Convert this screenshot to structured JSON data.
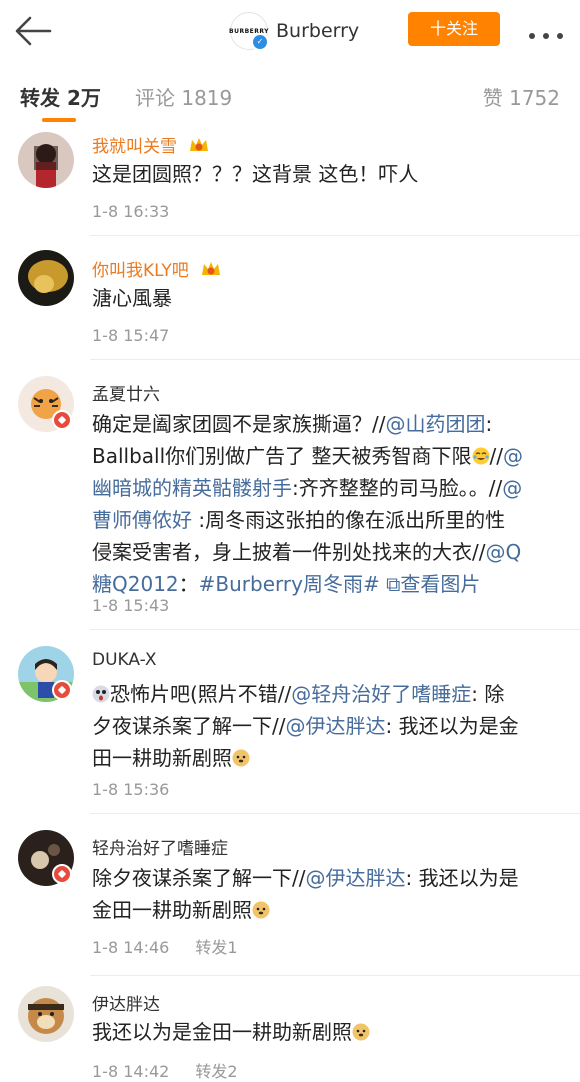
{
  "header": {
    "back_icon": "arrow-left-icon",
    "brand_mini": "BURBERRY",
    "brand_name": "Burberry",
    "follow_label": "十关注",
    "more_icon": "more-dots-icon"
  },
  "tabs": {
    "reposts": "转发 2万",
    "comments": "评论 1819",
    "likes": "赞 1752"
  },
  "colors": {
    "accent": "#ff8200",
    "link": "#466c9c",
    "vip_name": "#ea7a1e"
  },
  "reposts": [
    {
      "user": "我就叫关雪",
      "vip": true,
      "segments": [
        {
          "t": "这是团圆照？？？这背景 这色！吓人",
          "link": false
        }
      ],
      "time": "1-8 16:33",
      "repost": ""
    },
    {
      "user": "你叫我KLY吧",
      "vip": true,
      "segments": [
        {
          "t": "溏心風暴",
          "link": false
        }
      ],
      "time": "1-8 15:47",
      "repost": ""
    },
    {
      "user": "孟夏廿六",
      "vip": false,
      "segments": [
        {
          "t": "确定是阖家团圆不是家族撕逼？//",
          "link": false
        },
        {
          "t": "@山药团团",
          "link": true
        },
        {
          "t": ":\nBallball你们别做广告了 整天被秀智商下限",
          "link": false
        },
        {
          "t": "//",
          "link": false
        },
        {
          "t": "@\n幽暗城的精英骷髅射手",
          "link": true
        },
        {
          "t": ":齐齐整整的司马脸。。//",
          "link": false
        },
        {
          "t": "@\n曹师傅侬好",
          "link": true
        },
        {
          "t": " :周冬雨这张拍的像在派出所里的性\n侵案受害者，身上披着一件别处找来的大衣//",
          "link": false
        },
        {
          "t": "@Q\n糖Q2012",
          "link": true
        },
        {
          "t": "：",
          "link": false
        },
        {
          "t": "#Burberry周冬雨#",
          "link": true
        },
        {
          "t": " ",
          "link": false
        },
        {
          "t": "⧉查看图片",
          "link": true
        }
      ],
      "time": "1-8 15:43",
      "repost": ""
    },
    {
      "user": "DUKA-X",
      "vip": false,
      "segments": [
        {
          "t": "恐怖片吧(照片不错//",
          "link": false
        },
        {
          "t": "@轻舟治好了嗜睡症",
          "link": true
        },
        {
          "t": ": 除\n夕夜谋杀案了解一下//",
          "link": false
        },
        {
          "t": "@伊达胖达",
          "link": true
        },
        {
          "t": ": 我还以为是金\n田一耕助新剧照",
          "link": false
        }
      ],
      "time": "1-8 15:36",
      "repost": ""
    },
    {
      "user": "轻舟治好了嗜睡症",
      "vip": false,
      "segments": [
        {
          "t": "除夕夜谋杀案了解一下//",
          "link": false
        },
        {
          "t": "@伊达胖达",
          "link": true
        },
        {
          "t": ": 我还以为是\n金田一耕助新剧照",
          "link": false
        }
      ],
      "time": "1-8 14:46",
      "repost": "转发1"
    },
    {
      "user": "伊达胖达",
      "vip": false,
      "segments": [
        {
          "t": "我还以为是金田一耕助新剧照",
          "link": false
        }
      ],
      "time": "1-8 14:42",
      "repost": "转发2"
    }
  ]
}
